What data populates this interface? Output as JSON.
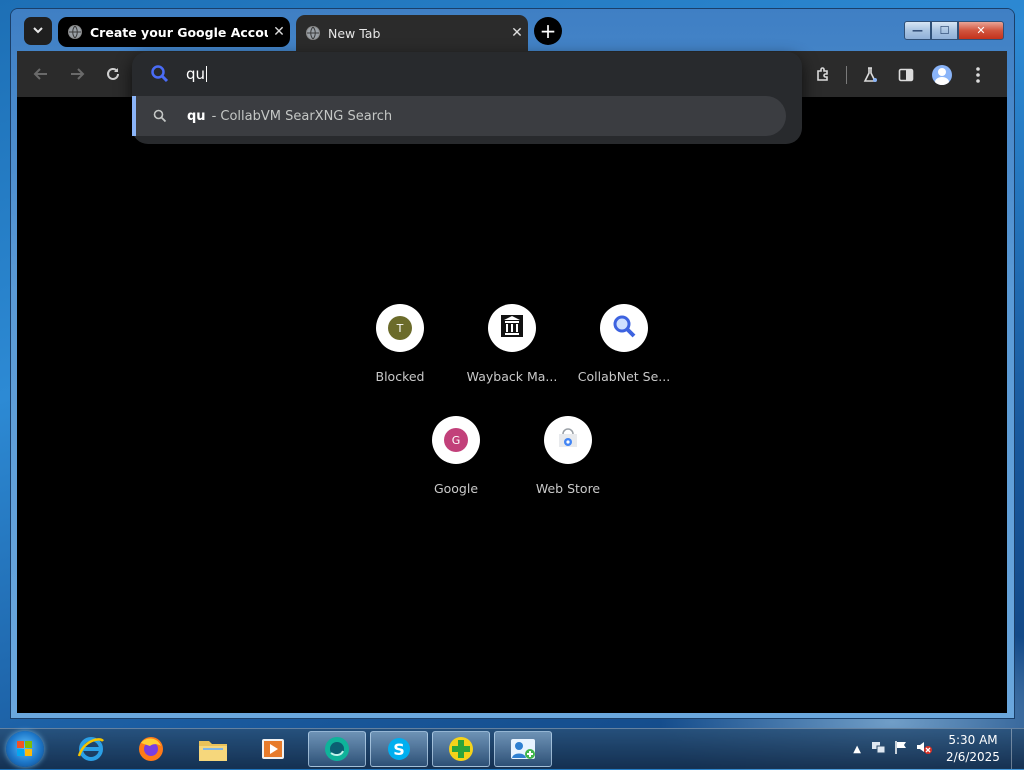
{
  "browser": {
    "tabs": [
      {
        "title": "Create your Google Account",
        "close": "✕"
      },
      {
        "title": "New Tab",
        "close": "✕"
      }
    ],
    "new_tab": "+",
    "tab_search": "⌄"
  },
  "window_controls": {
    "minimize": "—",
    "maximize": "☐",
    "close": "✕"
  },
  "omnibox": {
    "typed": "qu",
    "suggestion": {
      "query": "qu",
      "engine": "- CollabVM SearXNG Search"
    }
  },
  "shortcuts": [
    {
      "label": "Blocked",
      "letter": "T",
      "color": "#6b6b2a"
    },
    {
      "label": "Wayback Ma...",
      "icon": "wayback-icon"
    },
    {
      "label": "CollabNet Se...",
      "icon": "search-icon"
    },
    {
      "label": "Google",
      "letter": "G",
      "color": "#c2407a"
    },
    {
      "label": "Web Store",
      "icon": "webstore-icon"
    }
  ],
  "taskbar": {
    "apps": [
      "internet-explorer",
      "firefox",
      "file-explorer",
      "media-player",
      "chrome-like-app",
      "skype",
      "plus-app",
      "user-app"
    ],
    "time": "5:30 AM",
    "date": "2/6/2025"
  },
  "colors": {
    "accent": "#8ab4f8",
    "bg": "#000000",
    "toolbar": "#2b2b2b"
  }
}
